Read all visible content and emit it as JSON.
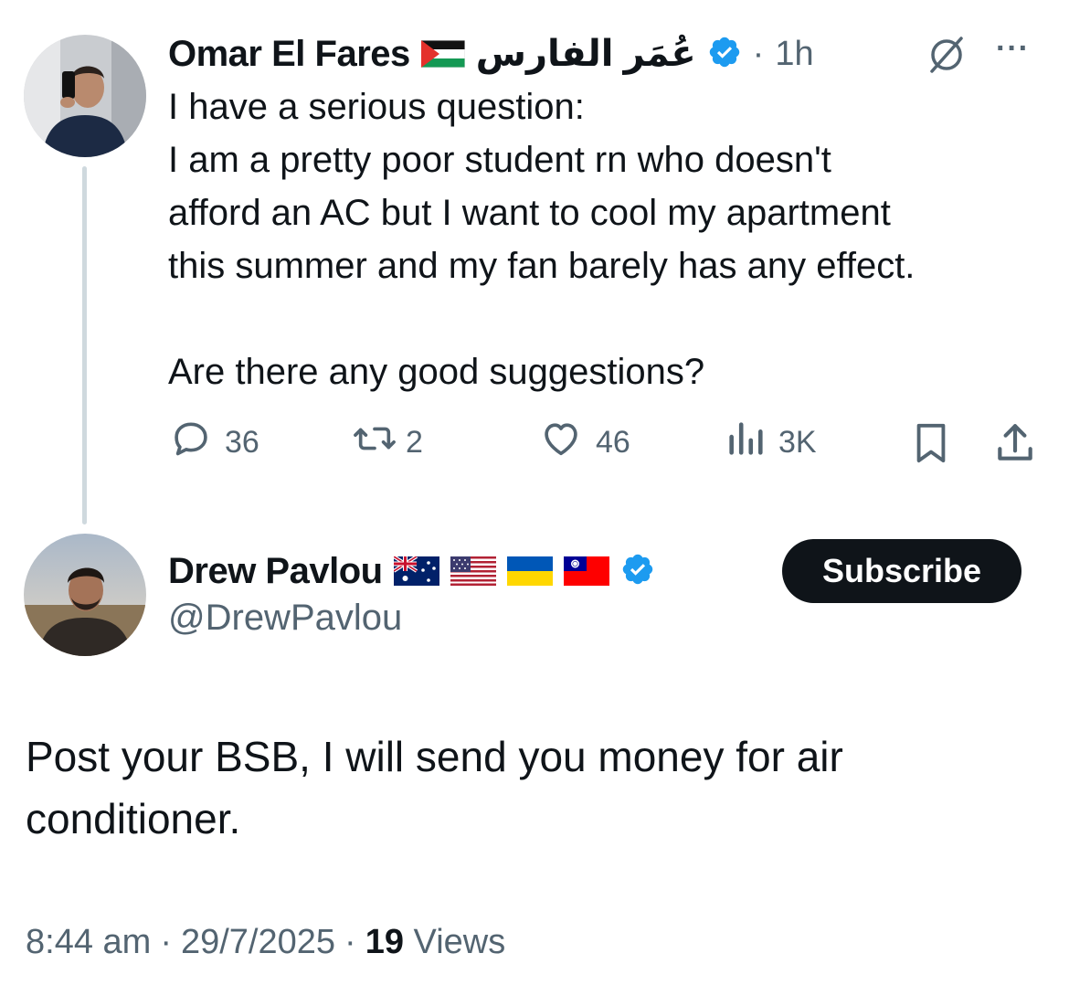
{
  "post": {
    "author_name": "Omar El Fares",
    "author_arabic": "عُمَر الفارس",
    "separator": "·",
    "time": "1h",
    "more_label": "···",
    "text": "I have a serious question:\nI am a pretty poor student rn who doesn't\nafford an AC but I want to cool my apartment\nthis summer and my fan barely has any effect.\n\nAre there any good suggestions?",
    "replies": "36",
    "reposts": "2",
    "likes": "46",
    "views": "3K"
  },
  "reply": {
    "author_name": "Drew Pavlou",
    "handle": "@DrewPavlou",
    "subscribe_label": "Subscribe",
    "text": "Post your BSB, I will send you money for air\nconditioner.",
    "time": "8:44 am",
    "sep1": "·",
    "date": "29/7/2025",
    "sep2": "·",
    "views_count": "19",
    "views_label": "Views"
  },
  "colors": {
    "verified": "#1d9bf0",
    "text": "#0f1419",
    "muted": "#536471",
    "button_bg": "#0f1419",
    "thread_line": "#cfd9de"
  }
}
